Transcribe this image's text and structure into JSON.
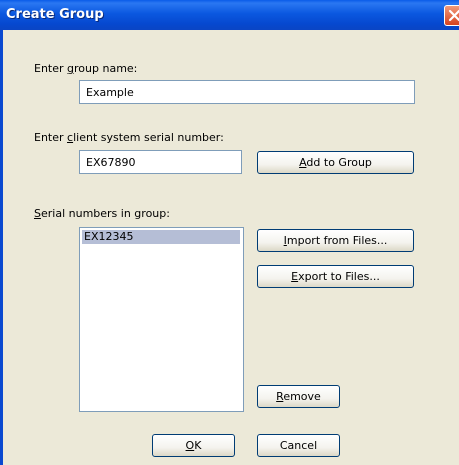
{
  "window": {
    "title": "Create Group"
  },
  "group_name": {
    "label_pre": "Enter ",
    "label_mnemonic": "g",
    "label_post": "roup name:",
    "value": "Example"
  },
  "serial_input": {
    "label_pre": "Enter ",
    "label_mnemonic": "c",
    "label_post": "lient system serial number:",
    "value": "EX67890"
  },
  "serials_list": {
    "label_mnemonic": "S",
    "label_post": "erial numbers in group:",
    "items": [
      "EX12345"
    ]
  },
  "buttons": {
    "add": {
      "mnemonic": "A",
      "rest": "dd to Group"
    },
    "import": {
      "mnemonic": "I",
      "rest": "mport from Files..."
    },
    "export": {
      "mnemonic": "E",
      "rest": "xport to Files..."
    },
    "remove": {
      "mnemonic": "R",
      "rest": "emove"
    },
    "ok": {
      "mnemonic": "O",
      "rest": "K"
    },
    "cancel": {
      "label": "Cancel"
    }
  },
  "icons": {
    "close": "close-x-icon"
  },
  "colors": {
    "titlebar": "#0a5be8",
    "dialog_bg": "#ece9d8",
    "selection": "#b5bed6",
    "close_button": "#d8421e"
  }
}
